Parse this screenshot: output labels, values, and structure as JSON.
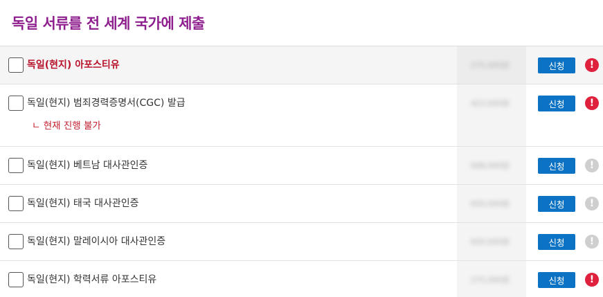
{
  "page": {
    "title": "독일 서류를 전 세계 국가에 제출"
  },
  "colors": {
    "title": "#8e1e8e",
    "highlight_label": "#b8122b",
    "button": "#0b72c4",
    "alert_red": "#e0213e",
    "alert_gray": "#cfcfcf"
  },
  "items": [
    {
      "label": "독일(현지) 아포스티유",
      "price": "275,000원",
      "button": "신청",
      "alert": "red",
      "emphasized": true
    },
    {
      "label": "독일(현지) 범죄경력증명서(CGC) 발급",
      "sublabel": "ㄴ 현재 진행 불가",
      "price": "423,000원",
      "button": "신청",
      "alert": "red"
    },
    {
      "label": "독일(현지) 베트남 대사관인증",
      "price": "698,000원",
      "button": "신청",
      "alert": "gray"
    },
    {
      "label": "독일(현지) 태국 대사관인증",
      "price": "650,000원",
      "button": "신청",
      "alert": "gray"
    },
    {
      "label": "독일(현지) 말레이시아 대사관인증",
      "price": "650,000원",
      "button": "신청",
      "alert": "gray"
    },
    {
      "label": "독일(현지) 학력서류 아포스티유",
      "price": "275,000원",
      "button": "신청",
      "alert": "red"
    }
  ]
}
